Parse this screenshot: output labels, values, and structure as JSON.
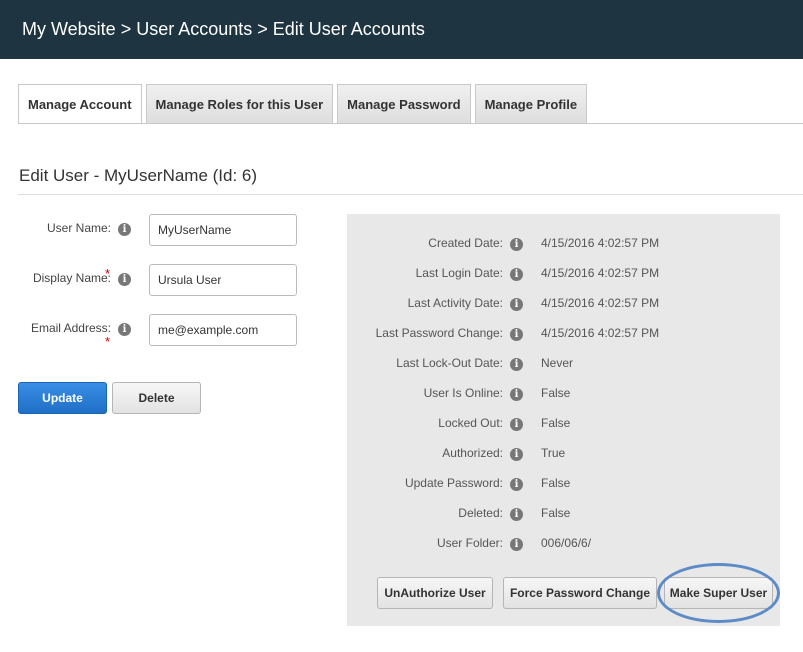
{
  "header": {
    "breadcrumb": "My Website > User Accounts > Edit User Accounts"
  },
  "tabs": [
    {
      "label": "Manage Account",
      "active": true
    },
    {
      "label": "Manage Roles for this User",
      "active": false
    },
    {
      "label": "Manage Password",
      "active": false
    },
    {
      "label": "Manage Profile",
      "active": false
    }
  ],
  "page_title": "Edit User - MyUserName (Id: 6)",
  "form": {
    "username_label": "User Name:",
    "username_value": "MyUserName",
    "displayname_label": "Display Name:",
    "displayname_value": "Ursula User",
    "email_label": "Email Address:",
    "email_value": "me@example.com",
    "required_mark": "*",
    "update_label": "Update",
    "delete_label": "Delete"
  },
  "info": {
    "rows": [
      {
        "label": "Created Date:",
        "value": "4/15/2016 4:02:57 PM"
      },
      {
        "label": "Last Login Date:",
        "value": "4/15/2016 4:02:57 PM"
      },
      {
        "label": "Last Activity Date:",
        "value": "4/15/2016 4:02:57 PM"
      },
      {
        "label": "Last Password Change:",
        "value": "4/15/2016 4:02:57 PM"
      },
      {
        "label": "Last Lock-Out Date:",
        "value": "Never"
      },
      {
        "label": "User Is Online:",
        "value": "False"
      },
      {
        "label": "Locked Out:",
        "value": "False"
      },
      {
        "label": "Authorized:",
        "value": "True"
      },
      {
        "label": "Update Password:",
        "value": "False"
      },
      {
        "label": "Deleted:",
        "value": "False"
      },
      {
        "label": "User Folder:",
        "value": "006/06/6/"
      }
    ],
    "unauthorize_label": "UnAuthorize User",
    "force_password_label": "Force Password Change",
    "make_super_label": "Make Super User"
  },
  "icons": {
    "info": "info-icon",
    "info_glyph": "i"
  },
  "colors": {
    "header_bg": "#1e3440",
    "primary": "#2d7fd6",
    "highlight": "#5d8bc7",
    "required": "#cc0000"
  }
}
